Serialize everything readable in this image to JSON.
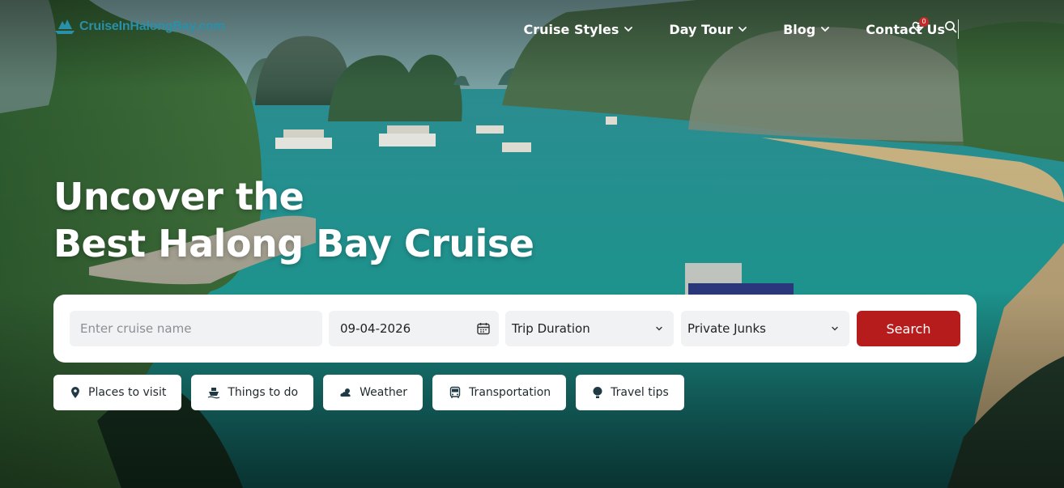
{
  "header": {
    "logo_text": "CruiseInHalongBay.com",
    "nav": [
      {
        "label": "Cruise Styles",
        "has_dropdown": true
      },
      {
        "label": "Day Tour",
        "has_dropdown": true
      },
      {
        "label": "Blog",
        "has_dropdown": true
      },
      {
        "label": "Contact Us",
        "has_dropdown": false
      }
    ],
    "wishlist_count": "0",
    "icons": {
      "wishlist": "heart-icon",
      "search": "search-icon"
    }
  },
  "hero": {
    "title_line1": "Uncover the",
    "title_line2": "Best Halong Bay Cruise"
  },
  "search": {
    "cruise_placeholder": "Enter cruise name",
    "date_value": "09-04-2026",
    "duration_value": "Trip Duration",
    "type_value": "Private Junks",
    "button_label": "Search"
  },
  "quick_links": [
    {
      "label": "Places to visit",
      "icon": "map-pin-icon"
    },
    {
      "label": "Things to do",
      "icon": "boat-icon"
    },
    {
      "label": "Weather",
      "icon": "weather-icon"
    },
    {
      "label": "Transportation",
      "icon": "bus-icon"
    },
    {
      "label": "Travel tips",
      "icon": "balloon-icon"
    }
  ],
  "colors": {
    "accent": "#b71c1c",
    "logo": "#2a8fa8",
    "text_dark": "#1f2a2e",
    "field_bg": "#f1f2f4"
  }
}
